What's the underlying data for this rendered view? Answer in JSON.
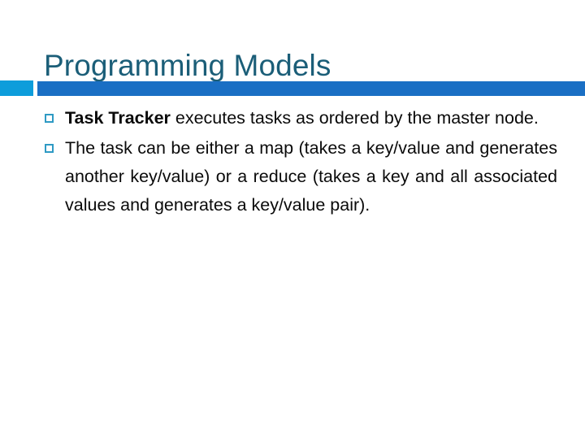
{
  "slide": {
    "title": "Programming Models",
    "title_color": "#1b5e78",
    "background_color": "#ffffff",
    "divider": {
      "square_color": "#0d9ddb",
      "line_color": "#1a6fc4"
    },
    "bullet_marker": {
      "shape": "hollow-square",
      "border_color": "#2e9ac4"
    },
    "bullets": [
      {
        "lead": "Task Tracker",
        "lead_bold": true,
        "rest": " executes tasks as ordered by the master node.",
        "full_text": "Task Tracker executes tasks as ordered by the master node."
      },
      {
        "lead": "",
        "lead_bold": false,
        "rest": "The task can be either a map (takes a key/value and generates another key/value) or a reduce (takes a key and all associated values and generates a key/value pair).",
        "full_text": "The task can be either a map (takes a key/value and generates another key/value) or a reduce (takes a key and all associated values and generates a key/value pair)."
      }
    ]
  }
}
